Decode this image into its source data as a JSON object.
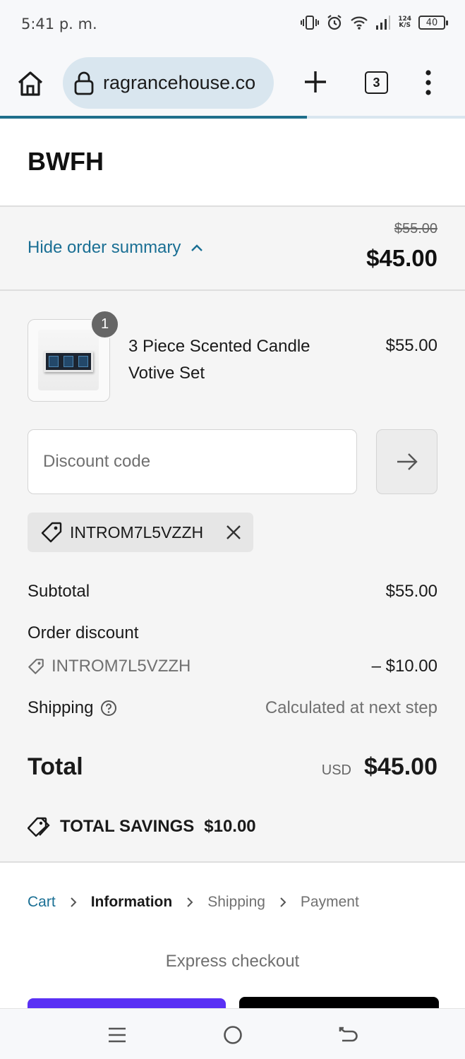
{
  "status_bar": {
    "time": "5:41 p. m.",
    "speed_value": "124",
    "speed_unit": "K/S",
    "battery": "40"
  },
  "browser": {
    "url": "ragrancehouse.co",
    "tab_count": "3",
    "load_progress": 0.66,
    "accent_color": "#1f6f8b"
  },
  "store": {
    "name": "BWFH"
  },
  "summary_toggle": {
    "label": "Hide order summary",
    "original_price": "$55.00",
    "price": "$45.00"
  },
  "line_item": {
    "quantity": "1",
    "name": "3 Piece Scented Candle Votive Set",
    "price": "$55.00"
  },
  "discount": {
    "placeholder": "Discount code",
    "applied_code": "INTROM7L5VZZH"
  },
  "totals": {
    "subtotal_label": "Subtotal",
    "subtotal_value": "$55.00",
    "order_discount_label": "Order discount",
    "discount_code": "INTROM7L5VZZH",
    "discount_value": "– $10.00",
    "shipping_label": "Shipping",
    "shipping_value": "Calculated at next step",
    "total_label": "Total",
    "currency": "USD",
    "total_value": "$45.00",
    "savings_label": "TOTAL SAVINGS",
    "savings_value": "$10.00"
  },
  "breadcrumb": {
    "items": [
      "Cart",
      "Information",
      "Shipping",
      "Payment"
    ]
  },
  "express": {
    "label": "Express checkout"
  },
  "icons": [
    "home-icon",
    "lock-icon",
    "plus-icon",
    "more-vert-icon",
    "chevron-up-icon",
    "arrow-right-icon",
    "tag-icon",
    "close-icon",
    "help-icon",
    "chevron-right-icon",
    "menu-icon",
    "circle-home-icon",
    "back-icon"
  ]
}
